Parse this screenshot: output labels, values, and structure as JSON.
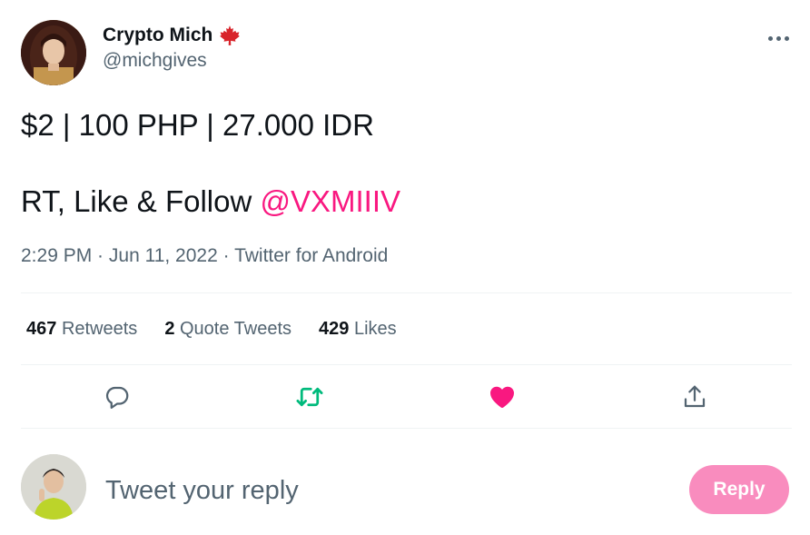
{
  "author": {
    "display_name": "Crypto Mich",
    "flag_icon": "maple-leaf-icon",
    "handle": "@michgives"
  },
  "tweet": {
    "line1": "$2 | 100 PHP | 27.000 IDR",
    "line2_prefix": "RT, Like & Follow ",
    "mention": "@VXMIIIV",
    "time": "2:29 PM",
    "date": "Jun 11, 2022",
    "source": "Twitter for Android",
    "separator": " · "
  },
  "stats": [
    {
      "count": "467",
      "label": "Retweets"
    },
    {
      "count": "2",
      "label": "Quote Tweets"
    },
    {
      "count": "429",
      "label": "Likes"
    }
  ],
  "actions": {
    "reply_icon": "reply-icon",
    "retweet_icon": "retweet-icon",
    "like_icon": "heart-icon",
    "share_icon": "share-icon"
  },
  "reply": {
    "placeholder": "Tweet your reply",
    "button_label": "Reply"
  },
  "colors": {
    "accent_pink": "#f91880",
    "retweet_green": "#00ba7c",
    "reply_button": "#f98cbe",
    "secondary_text": "#536471"
  }
}
